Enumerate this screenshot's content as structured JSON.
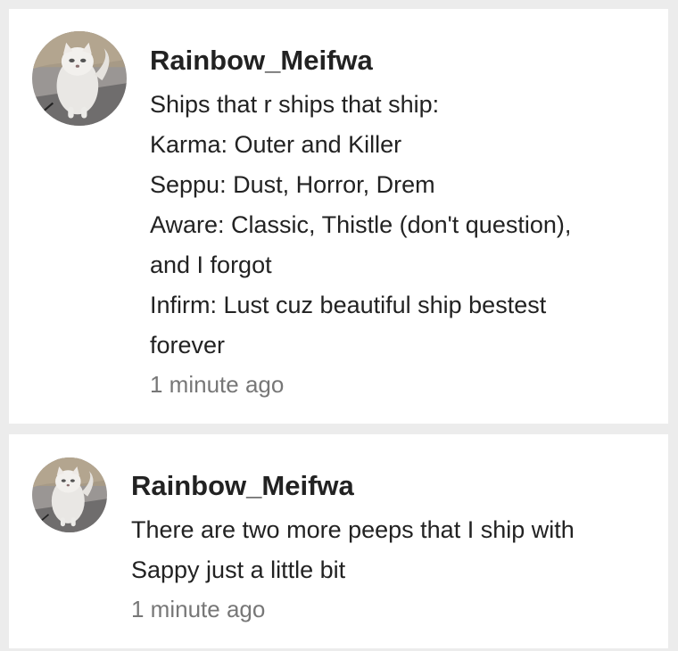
{
  "comments": [
    {
      "username": "Rainbow_Meifwa",
      "avatar_icon": "white-persian-cat-avatar",
      "lines": [
        "Ships that r ships that ship:",
        "Karma: Outer and Killer",
        "Seppu: Dust, Horror, Drem",
        "Aware: Classic, Thistle (don't question),",
        "and I forgot",
        "Infirm: Lust cuz beautiful ship bestest",
        "forever"
      ],
      "timestamp": "1 minute ago"
    },
    {
      "username": "Rainbow_Meifwa",
      "avatar_icon": "white-persian-cat-avatar",
      "lines": [
        "There are two more peeps that I ship with",
        "Sappy just a little bit"
      ],
      "timestamp": "1 minute ago"
    }
  ],
  "colors": {
    "background": "#ececec",
    "card": "#ffffff",
    "text": "#222222",
    "timestamp": "#777777"
  }
}
